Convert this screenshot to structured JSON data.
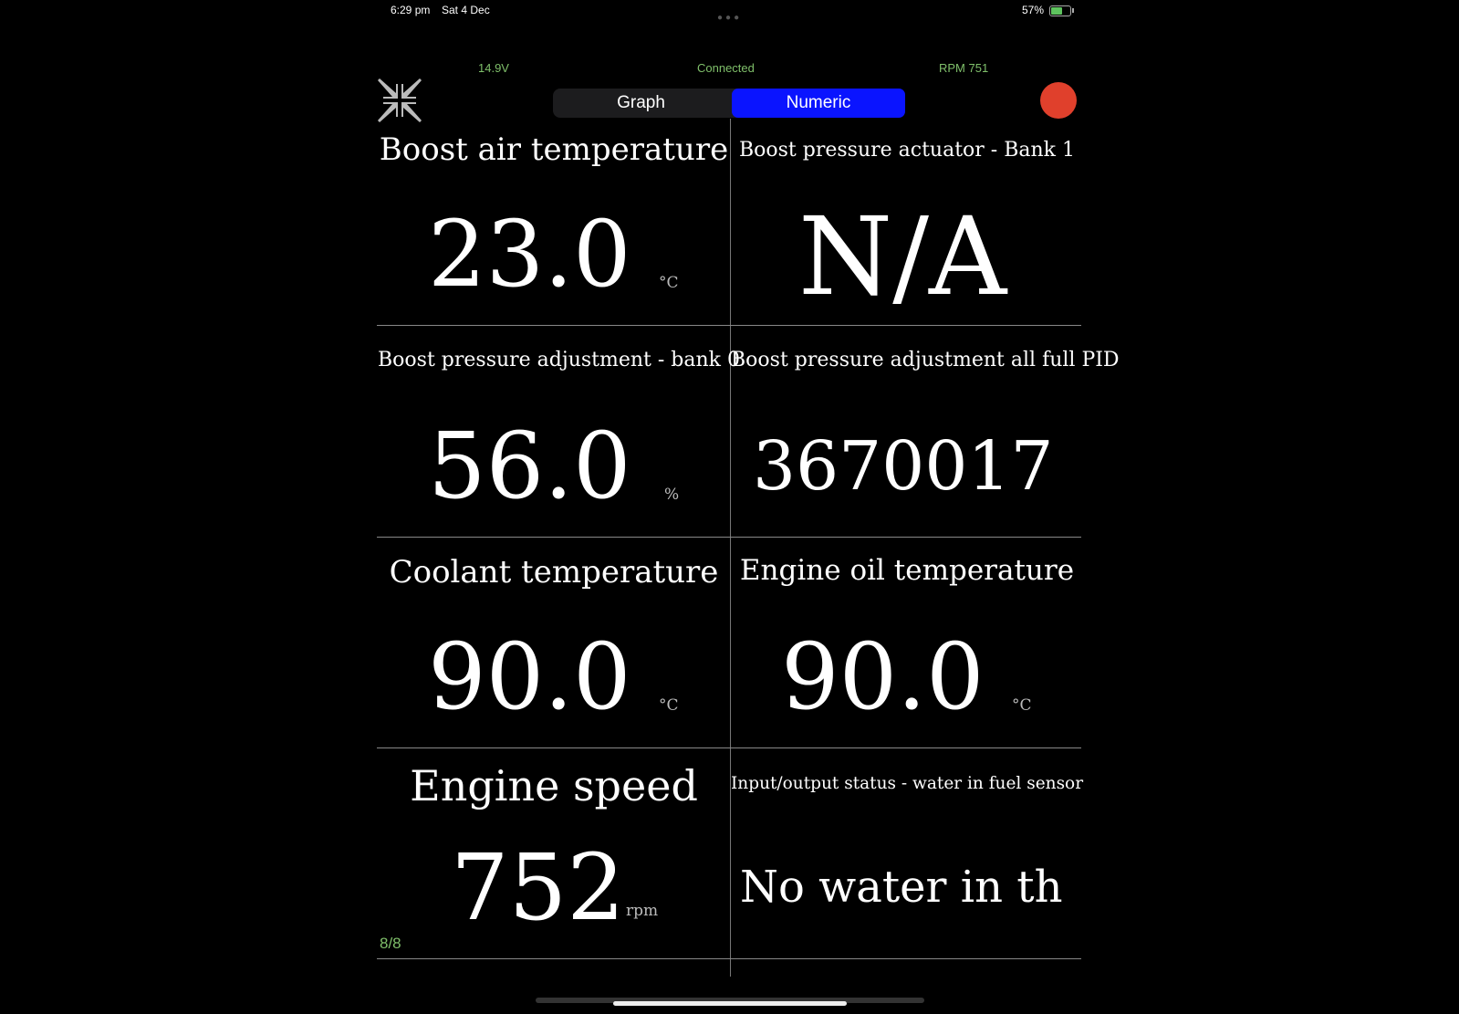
{
  "status_bar": {
    "time": "6:29 pm",
    "date": "Sat 4 Dec",
    "battery": "57%"
  },
  "header": {
    "voltage": "14.9V",
    "connection": "Connected",
    "rpm": "RPM 751"
  },
  "tabs": {
    "graph": "Graph",
    "numeric": "Numeric",
    "selected": "Numeric"
  },
  "colors": {
    "accent": "#0a14ff",
    "record": "#e0402c",
    "status_green": "#7fbf6a"
  },
  "icons": {
    "collapse": "collapse-arrows-icon",
    "record": "record-button"
  },
  "gauges": [
    {
      "title": "Boost air temperature",
      "value": "23.0",
      "unit": "°C"
    },
    {
      "title": "Boost pressure actuator  -  Bank 1",
      "value": "N/A",
      "unit": ""
    },
    {
      "title": "Boost pressure adjustment - bank 0",
      "value": "56.0",
      "unit": "%"
    },
    {
      "title": "Boost pressure adjustment all full PID",
      "value": "3670017",
      "unit": ""
    },
    {
      "title": "Coolant temperature",
      "value": "90.0",
      "unit": "°C"
    },
    {
      "title": "Engine oil temperature",
      "value": "90.0",
      "unit": "°C"
    },
    {
      "title": "Engine speed",
      "value": "752",
      "unit": "rpm"
    },
    {
      "title": "Input/output status - water in fuel sensor",
      "value": "No water in th",
      "unit": ""
    }
  ],
  "page_indicator": "8/8"
}
